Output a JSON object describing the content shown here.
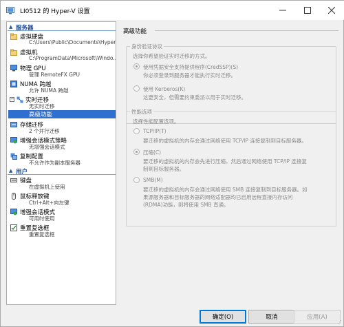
{
  "window": {
    "title": "LI0512 的 Hyper-V 设置"
  },
  "sidebar": {
    "server_header": "服务器",
    "user_header": "用户",
    "items": [
      {
        "label": "虚拟硬盘",
        "sub": "C:\\Users\\Public\\Documents\\Hyper-..."
      },
      {
        "label": "虚拟机",
        "sub": "C:\\ProgramData\\Microsoft\\Windo..."
      },
      {
        "label": "物理 GPU",
        "sub": "管理 RemoteFX GPU"
      },
      {
        "label": "NUMA 跨越",
        "sub": "允许 NUMA 跨越"
      },
      {
        "label": "实时迁移",
        "sub": "无实时迁移"
      },
      {
        "label": "高级功能"
      },
      {
        "label": "存储迁移",
        "sub": "2 个并行迁移"
      },
      {
        "label": "增强会话模式策略",
        "sub": "无增强会话模式"
      },
      {
        "label": "复制配置",
        "sub": "不允许作为副本服务器"
      },
      {
        "label": "键盘",
        "sub": "在虚拟机上使用"
      },
      {
        "label": "鼠标释放键",
        "sub": "Ctrl+Alt+向左键"
      },
      {
        "label": "增强会话模式",
        "sub": "可用时使用"
      },
      {
        "label": "重置复选框",
        "sub": "重置复选框"
      }
    ]
  },
  "panel": {
    "title": "高级功能",
    "auth": {
      "title": "身份验证协议",
      "desc": "选择你希望验证实时迁移的方式。",
      "opt1": "使用凭据安全支持提供程序(CredSSP)(S)",
      "opt1_desc": "你必须登录到服务器才能执行实时迁移。",
      "opt2": "使用 Kerberos(K)",
      "opt2_desc": "这更安全，但需要约束委派以用于实时迁移。"
    },
    "perf": {
      "title": "性能选项",
      "desc": "选择性能配置选项。",
      "opt1": "TCP/IP(T)",
      "opt1_desc1": "要迁移的虚拟机的内存会通过网络使用 TCP/IP 连接复制到目标服务器。",
      "opt2": "压缩(C)",
      "opt2_desc1": "要迁移的虚拟机的内存会先进行压缩，然后通过网络使用 TCP/IP 连接复",
      "opt2_desc2": "制到目标服务器。",
      "opt3": "SMB(M)",
      "opt3_desc1": "要迁移的虚拟机的内存会通过网络使用 SMB 连接复制到目标服务器。如",
      "opt3_desc2": "果源服务器和目标服务器的网络适配器均已启用远程直接内存访问",
      "opt3_desc3": "(RDMA)功能，则将使用 SMB 直通。"
    }
  },
  "footer": {
    "ok": "确定(O)",
    "cancel": "取消",
    "apply": "应用(A)"
  },
  "colors": {
    "accent": "#2f6fcf",
    "header_text": "#1f4e9c"
  }
}
